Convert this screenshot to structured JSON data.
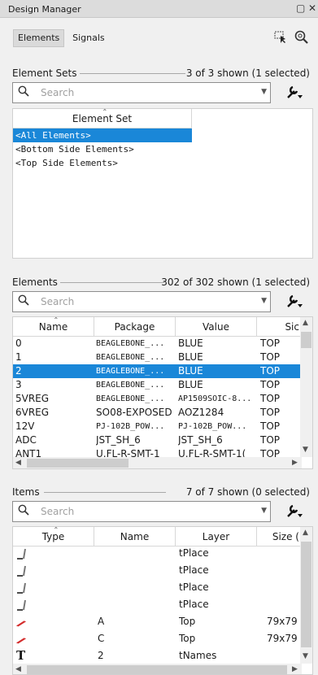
{
  "window": {
    "title": "Design Manager",
    "pin_icon": "pin-icon",
    "close_icon": "close-icon"
  },
  "tabs": [
    {
      "label": "Elements",
      "active": true
    },
    {
      "label": "Signals",
      "active": false
    }
  ],
  "toolbar": {
    "select_icon": "select-pointer-icon",
    "zoom_icon": "zoom-icon"
  },
  "element_sets": {
    "label": "Element Sets",
    "count": "3 of 3 shown (1 selected)",
    "search_placeholder": "Search",
    "column": "Element Set",
    "rows": [
      "<All Elements>",
      "<Bottom Side Elements>",
      "<Top Side Elements>"
    ],
    "selected_index": 0
  },
  "elements": {
    "label": "Elements",
    "count": "302 of 302 shown (1 selected)",
    "search_placeholder": "Search",
    "columns": [
      "Name",
      "Package",
      "Value",
      "Sic"
    ],
    "rows": [
      [
        "0",
        "BEAGLEBONE_...",
        "BLUE",
        "TOP"
      ],
      [
        "1",
        "BEAGLEBONE_...",
        "BLUE",
        "TOP"
      ],
      [
        "2",
        "BEAGLEBONE_...",
        "BLUE",
        "TOP"
      ],
      [
        "3",
        "BEAGLEBONE_...",
        "BLUE",
        "TOP"
      ],
      [
        "5VREG",
        "BEAGLEBONE_...",
        "AP1509SOIC-8...",
        "TOP"
      ],
      [
        "6VREG",
        "SO08-EXPOSED",
        "AOZ1284",
        "TOP"
      ],
      [
        "12V",
        "PJ-102B_POW...",
        "PJ-102B_POW...",
        "TOP"
      ],
      [
        "ADC",
        "JST_SH_6",
        "JST_SH_6",
        "TOP"
      ],
      [
        "ANT1",
        "U.FL-R-SMT-1",
        "U.FL-R-SMT-1(",
        "TOP"
      ]
    ],
    "selected_index": 2
  },
  "items": {
    "label": "Items",
    "count": "7 of 7 shown (0 selected)",
    "search_placeholder": "Search",
    "columns": [
      "Type",
      "Name",
      "Layer",
      "Size ("
    ],
    "rows": [
      {
        "type_icon": "wire-icon",
        "name": "",
        "layer": "tPlace",
        "size": ""
      },
      {
        "type_icon": "wire-icon",
        "name": "",
        "layer": "tPlace",
        "size": ""
      },
      {
        "type_icon": "wire-icon",
        "name": "",
        "layer": "tPlace",
        "size": ""
      },
      {
        "type_icon": "wire-icon",
        "name": "",
        "layer": "tPlace",
        "size": ""
      },
      {
        "type_icon": "smd-pad-icon",
        "name": "A",
        "layer": "Top",
        "size": "79x79 ("
      },
      {
        "type_icon": "smd-pad-icon",
        "name": "C",
        "layer": "Top",
        "size": "79x79 ("
      },
      {
        "type_icon": "text-icon",
        "name": "2",
        "layer": "tNames",
        "size": ""
      }
    ]
  },
  "colors": {
    "selection": "#1a87d8",
    "pad": "#d32b2b"
  }
}
